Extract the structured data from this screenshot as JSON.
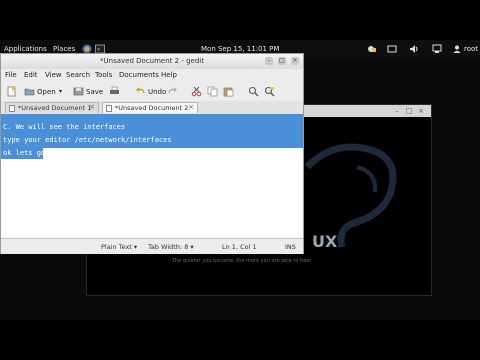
{
  "panel": {
    "applications": "Applications",
    "places": "Places",
    "clock": "Mon Sep 15, 11:01 PM",
    "user": "root"
  },
  "gedit": {
    "title": "*Unsaved Document 2 - gedit",
    "menu": [
      "File",
      "Edit",
      "View",
      "Search",
      "Tools",
      "Documents",
      "Help"
    ],
    "toolbar": {
      "open": "Open",
      "save": "Save",
      "undo": "Undo"
    },
    "tabs": [
      {
        "label": "*Unsaved Document 1"
      },
      {
        "label": "*Unsaved Document 2"
      }
    ],
    "lines": [
      "C. We will see the interfaces",
      "type your editor /etc/network/interfaces",
      "ok lets go"
    ],
    "status": {
      "mode": "Plain Text",
      "tab_width": "Tab Width: 8",
      "position": "Ln 1, Col 1",
      "ins": "INS"
    }
  },
  "background": {
    "logo_text": "UX",
    "tagline": "The quieter you become, the more you are able to hear"
  }
}
